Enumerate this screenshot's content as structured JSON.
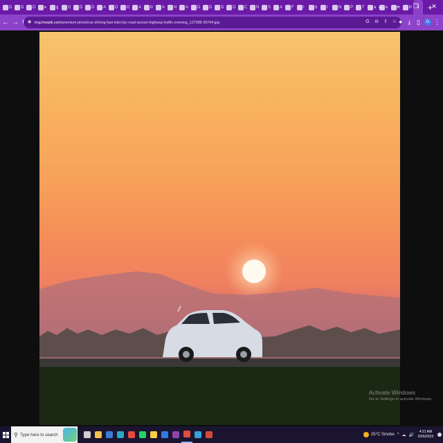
{
  "browser": {
    "tabs": [
      {
        "letter": "D"
      },
      {
        "letter": "D"
      },
      {
        "letter": "D"
      },
      {
        "letter": "e"
      },
      {
        "letter": "g"
      },
      {
        "letter": "G"
      },
      {
        "letter": "D"
      },
      {
        "letter": "D"
      },
      {
        "letter": "A"
      },
      {
        "letter": "D"
      },
      {
        "letter": "G"
      },
      {
        "letter": "A"
      },
      {
        "letter": "M"
      },
      {
        "letter": "A"
      },
      {
        "letter": "N"
      },
      {
        "letter": "A"
      },
      {
        "letter": "D"
      },
      {
        "letter": "D"
      },
      {
        "letter": "D"
      },
      {
        "letter": "D"
      },
      {
        "letter": "C"
      },
      {
        "letter": "N"
      },
      {
        "letter": "S"
      },
      {
        "letter": "A"
      },
      {
        "letter": "F"
      },
      {
        "letter": "I"
      },
      {
        "letter": "b"
      },
      {
        "letter": "I"
      },
      {
        "letter": "N"
      },
      {
        "letter": "P"
      },
      {
        "letter": "T"
      },
      {
        "letter": "a"
      },
      {
        "letter": "e"
      },
      {
        "letter": "o"
      },
      {
        "letter": "M"
      }
    ],
    "active_tab_close": "×",
    "new_tab": "+",
    "window_controls": {
      "minimize": "⌄",
      "restore": "–",
      "maximize": "❐",
      "close": "✕"
    }
  },
  "toolbar": {
    "back": "←",
    "forward": "→",
    "reload": "C",
    "url_host": "img.freepik.com",
    "url_path": "/premium-photo/car-driving-fast-intercity-road-sunset-highway-traffic-evening_127089-30764.jpg",
    "omnibox_icons": [
      "G",
      "⊖",
      "⇪",
      "☆"
    ],
    "right_icons": [
      "✦",
      "⤓",
      "▯"
    ],
    "profile_initial": "G",
    "menu": "⋮"
  },
  "viewer": {
    "watermark_title": "Activate Windows",
    "watermark_sub": "Go to Settings to activate Windows."
  },
  "taskbar": {
    "search_placeholder": "Type here to search",
    "apps": [
      {
        "name": "task-view",
        "color": "#d0d0d0"
      },
      {
        "name": "file-explorer",
        "color": "#f2c14e"
      },
      {
        "name": "calculator",
        "color": "#3a7bd5"
      },
      {
        "name": "edge",
        "color": "#2aa7c9"
      },
      {
        "name": "chrome",
        "color": "#e54b3c"
      },
      {
        "name": "whatsapp",
        "color": "#25d366"
      },
      {
        "name": "sticky",
        "color": "#f5d142"
      },
      {
        "name": "photos",
        "color": "#2d7ae5"
      },
      {
        "name": "chrome-profile",
        "color": "#8e44ad"
      },
      {
        "name": "chrome-active",
        "color": "#e54b3c"
      },
      {
        "name": "app-blue",
        "color": "#3aa0d8"
      },
      {
        "name": "app-red",
        "color": "#d44a3a"
      }
    ],
    "weather": "25°C  Smoke",
    "tray_icons": [
      "^",
      "☁",
      "🔊"
    ],
    "time": "4:21 AM",
    "date": "9/26/2023"
  },
  "colors": {
    "tabstrip": "#6a1aa6",
    "toolbar": "#8d43c9",
    "omnibox": "#5b1a94",
    "taskbar": "#1a1430"
  }
}
